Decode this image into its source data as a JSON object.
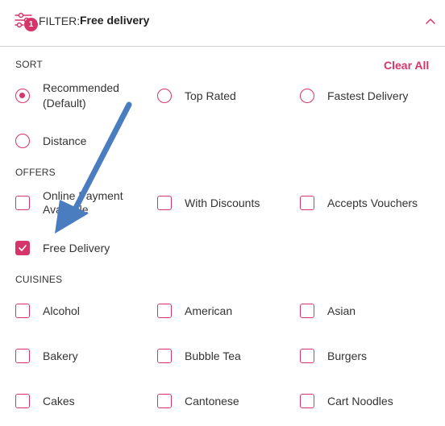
{
  "header": {
    "filter_label": "FILTER:",
    "filter_value": "Free delivery",
    "badge_count": "1",
    "accent_color": "#d6356a"
  },
  "sort": {
    "title": "SORT",
    "clear_all": "Clear All",
    "options": [
      {
        "label": "Recommended",
        "label2": "(Default)",
        "checked": true
      },
      {
        "label": "Top Rated",
        "checked": false
      },
      {
        "label": "Fastest Delivery",
        "checked": false
      },
      {
        "label": "Distance",
        "checked": false
      }
    ]
  },
  "offers": {
    "title": "OFFERS",
    "options": [
      {
        "label": "Online Payment",
        "label2": "Available",
        "checked": false
      },
      {
        "label": "With Discounts",
        "checked": false
      },
      {
        "label": "Accepts Vouchers",
        "checked": false
      },
      {
        "label": "Free Delivery",
        "checked": true
      }
    ]
  },
  "cuisines": {
    "title": "CUISINES",
    "options": [
      {
        "label": "Alcohol",
        "checked": false
      },
      {
        "label": "American",
        "checked": false
      },
      {
        "label": "Asian",
        "checked": false
      },
      {
        "label": "Bakery",
        "checked": false
      },
      {
        "label": "Bubble Tea",
        "checked": false
      },
      {
        "label": "Burgers",
        "checked": false
      },
      {
        "label": "Cakes",
        "checked": false
      },
      {
        "label": "Cantonese",
        "checked": false
      },
      {
        "label": "Cart Noodles",
        "checked": false
      }
    ]
  }
}
